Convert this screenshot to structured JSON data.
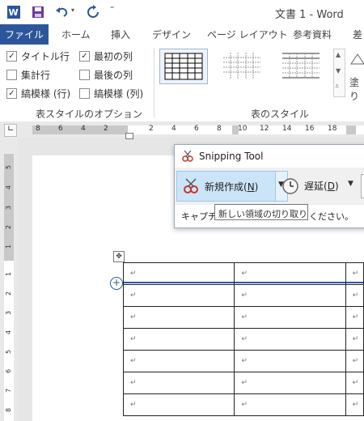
{
  "titlebar": {
    "title": "文書 1 - Word",
    "app_icon": "word-icon",
    "save_icon": "save-icon",
    "undo_icon": "undo-icon",
    "redo_icon": "redo-icon"
  },
  "tabs": [
    "ファイル",
    "ホーム",
    "挿入",
    "デザイン",
    "ページ レイアウト",
    "参考資料",
    "差"
  ],
  "table_style_options": {
    "header_row": {
      "label": "タイトル行",
      "checked": true
    },
    "first_column": {
      "label": "最初の列",
      "checked": true
    },
    "total_row": {
      "label": "集計行",
      "checked": false
    },
    "last_column": {
      "label": "最後の列",
      "checked": false
    },
    "banded_rows": {
      "label": "縞模様 (行)",
      "checked": true
    },
    "banded_columns": {
      "label": "縞模様 (列)",
      "checked": false
    },
    "group_label": "表スタイルのオプション"
  },
  "table_styles": {
    "group_label": "表のスタイル",
    "shading_label": "塗り"
  },
  "ruler": {
    "h_numbers": [
      "8",
      "6",
      "4",
      "2",
      "2",
      "4",
      "6",
      "8",
      "10",
      "12",
      "14",
      "16",
      "18"
    ],
    "v_numbers": [
      "5",
      "4",
      "3",
      "2",
      "1",
      "1",
      "2",
      "3",
      "4",
      "5",
      "6",
      "7",
      "8"
    ]
  },
  "snipping_tool": {
    "title": "Snipping Tool",
    "new_label": "新規作成(",
    "new_key": "N",
    "new_close": ")",
    "delay_label": "遅延(",
    "delay_key": "D",
    "delay_close": ")",
    "status_prefix": "キャプチャ",
    "status_suffix": "ください。",
    "tooltip": "新しい領域の切り取り"
  },
  "document": {
    "paragraph_mark": "↵",
    "rows": 7,
    "cols": 3
  },
  "colors": {
    "accent": "#2b579a",
    "selected_button": "#cce4f7"
  }
}
